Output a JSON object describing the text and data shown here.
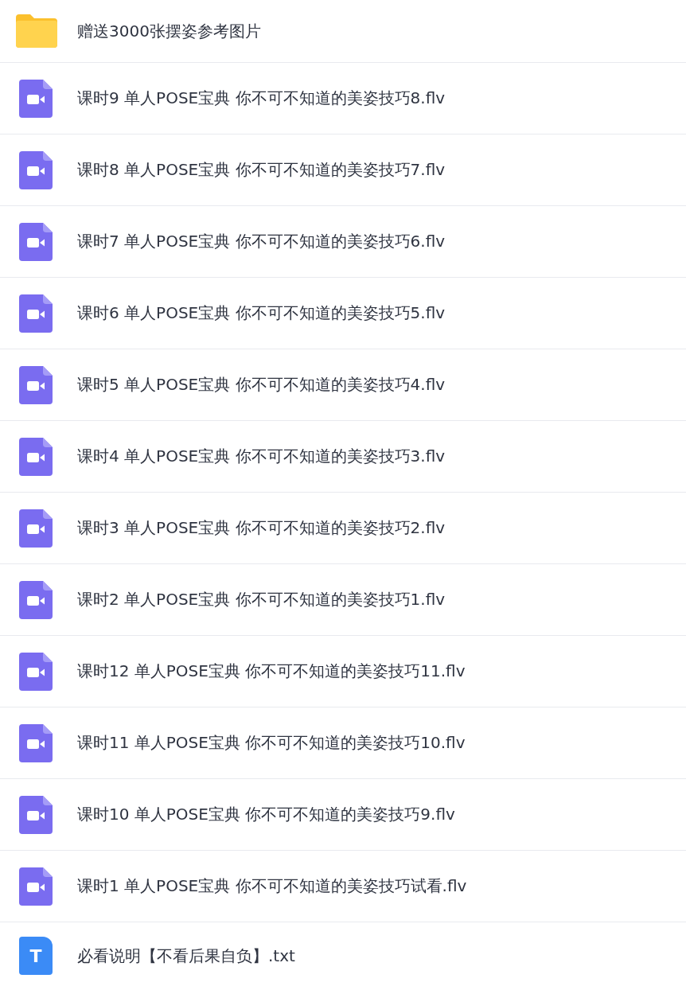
{
  "files": [
    {
      "kind": "folder",
      "name": "赠送3000张摆姿参考图片"
    },
    {
      "kind": "video",
      "name": "课时9 单人POSE宝典 你不可不知道的美姿技巧8.flv"
    },
    {
      "kind": "video",
      "name": "课时8 单人POSE宝典 你不可不知道的美姿技巧7.flv"
    },
    {
      "kind": "video",
      "name": "课时7 单人POSE宝典 你不可不知道的美姿技巧6.flv"
    },
    {
      "kind": "video",
      "name": "课时6 单人POSE宝典 你不可不知道的美姿技巧5.flv"
    },
    {
      "kind": "video",
      "name": "课时5 单人POSE宝典 你不可不知道的美姿技巧4.flv"
    },
    {
      "kind": "video",
      "name": "课时4 单人POSE宝典 你不可不知道的美姿技巧3.flv"
    },
    {
      "kind": "video",
      "name": "课时3 单人POSE宝典 你不可不知道的美姿技巧2.flv"
    },
    {
      "kind": "video",
      "name": "课时2 单人POSE宝典 你不可不知道的美姿技巧1.flv"
    },
    {
      "kind": "video",
      "name": "课时12 单人POSE宝典 你不可不知道的美姿技巧11.flv"
    },
    {
      "kind": "video",
      "name": "课时11 单人POSE宝典 你不可不知道的美姿技巧10.flv"
    },
    {
      "kind": "video",
      "name": "课时10 单人POSE宝典 你不可不知道的美姿技巧9.flv"
    },
    {
      "kind": "video",
      "name": "课时1 单人POSE宝典 你不可不知道的美姿技巧试看.flv"
    },
    {
      "kind": "text",
      "name": "必看说明【不看后果自负】.txt",
      "icon_letter": "T"
    }
  ]
}
